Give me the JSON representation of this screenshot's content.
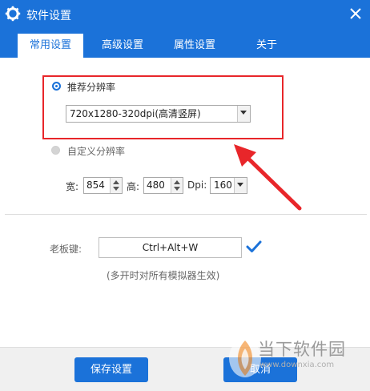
{
  "window": {
    "title": "软件设置"
  },
  "tabs": [
    {
      "label": "常用设置"
    },
    {
      "label": "高级设置"
    },
    {
      "label": "属性设置"
    },
    {
      "label": "关于"
    }
  ],
  "resolution": {
    "recommended_label": "推荐分辨率",
    "recommended_value": "720x1280-320dpi(高清竖屏)",
    "custom_label": "自定义分辨率",
    "width_label": "宽:",
    "width_value": "854",
    "height_label": "高:",
    "height_value": "480",
    "dpi_label": "Dpi:",
    "dpi_value": "160"
  },
  "boss_key": {
    "label": "老板键:",
    "value": "Ctrl+Alt+W",
    "note": "(多开时对所有模拟器生效)"
  },
  "buttons": {
    "save": "保存设置",
    "cancel": "取消"
  },
  "watermark": {
    "text": "当下软件园",
    "url": "www.downxia.com"
  },
  "colors": {
    "accent": "#1b72d9",
    "highlight_box": "#e8262a",
    "check": "#1b72d9"
  }
}
